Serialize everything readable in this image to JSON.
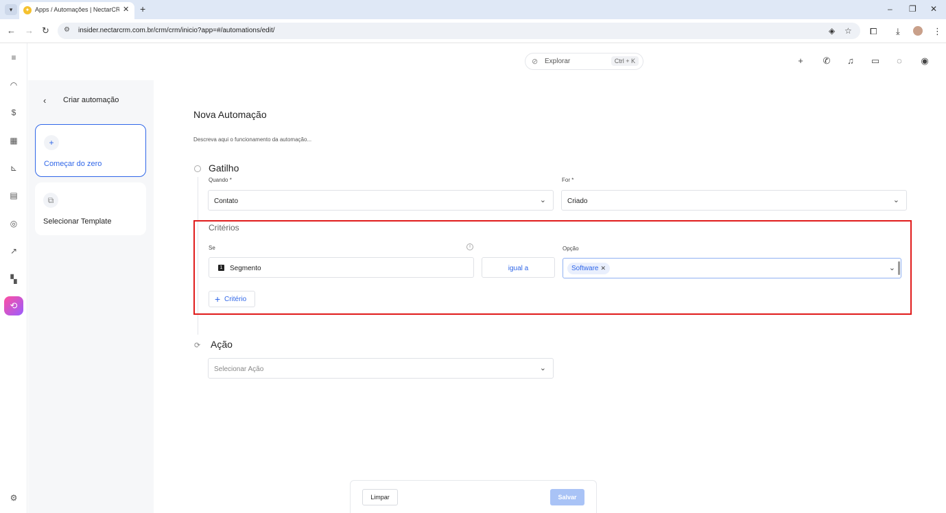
{
  "browser": {
    "tab_title": "Apps / Automações | NectarCRM",
    "tab_close": "✕",
    "new_tab": "+",
    "url": "insider.nectarcrm.com.br/crm/crm/inicio?app=#/automations/edit/",
    "window_controls": [
      "–",
      "❐",
      "✕"
    ]
  },
  "topbar": {
    "explore_placeholder": "Explorar",
    "explore_shortcut": "Ctrl + K"
  },
  "sidebar_panel": {
    "title": "Criar automação",
    "cards": [
      {
        "icon": "+",
        "label": "Começar do zero",
        "selected": true
      },
      {
        "icon": "⧉",
        "label": "Selecionar Template",
        "selected": false
      }
    ]
  },
  "form": {
    "title": "Nova Automação",
    "description_placeholder": "Descreva aqui o funcionamento da automação...",
    "trigger": {
      "title": "Gatilho",
      "when_label": "Quando *",
      "when_value": "Contato",
      "for_label": "For *",
      "for_value": "Criado"
    },
    "criteria": {
      "title": "Critérios",
      "if_label": "Se",
      "field_badge": "1",
      "field_value": "Segmento",
      "operator": "igual a",
      "option_label": "Opção",
      "option_chip": "Software",
      "add_button": "Critério"
    },
    "action": {
      "title": "Ação",
      "select_placeholder": "Selecionar Ação"
    }
  },
  "footer": {
    "clear_label": "Limpar",
    "save_label": "Salvar"
  },
  "colors": {
    "accent": "#2f66e8",
    "highlight": "#e01a1a"
  }
}
